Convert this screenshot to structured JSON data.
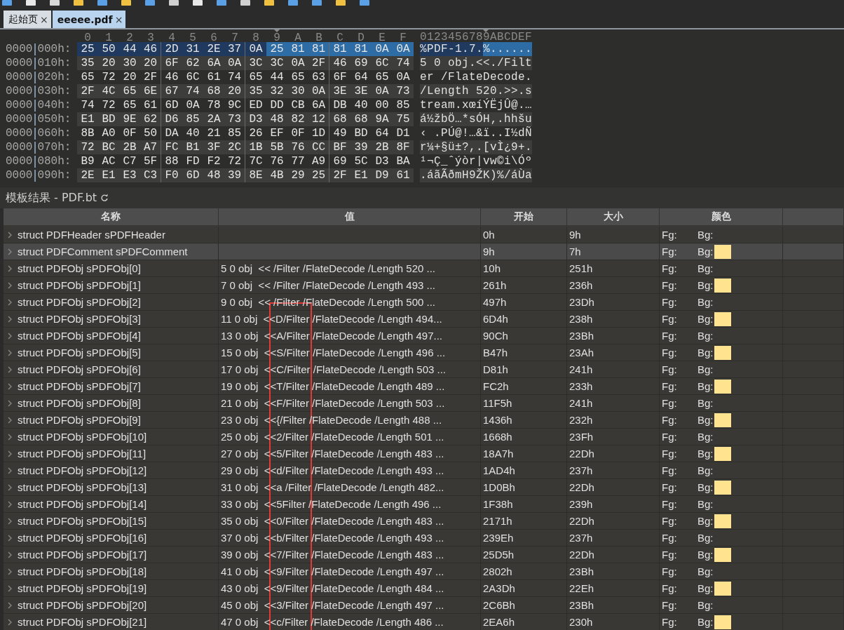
{
  "tabs": [
    {
      "label": "起始页",
      "close": "×",
      "selected": false
    },
    {
      "label": "eeeee.pdf",
      "close": "×",
      "selected": true
    }
  ],
  "hex_view": {
    "column_headers": [
      "0",
      "1",
      "2",
      "3",
      "4",
      "5",
      "6",
      "7",
      "8",
      "9",
      "A",
      "B",
      "C",
      "D",
      "E",
      "F"
    ],
    "text_header": "0123456789ABCDEF",
    "rows": [
      {
        "segment": "0000",
        "offset": "000h:",
        "cells": [
          {
            "bytes": "25 50 44 46 2D 31 2E 37 0A",
            "selected": true,
            "cursor": false
          },
          {
            "bytes": "25 81 81 81 81 0A 0A",
            "selected": true,
            "cursor": true
          }
        ],
        "text": [
          {
            "text": "%PDF-1.7.",
            "selected": true,
            "cursor": false
          },
          {
            "text": "%......",
            "selected": true,
            "cursor": true
          }
        ]
      },
      {
        "segment": "0000",
        "offset": "010h:",
        "cells": [
          {
            "bytes": "35 20 30 20 6F 62 6A 0A 3C 3C 0A 2F 46 69 6C 74",
            "selected": false,
            "cursor": false
          }
        ],
        "text": [
          {
            "text": "5 0 obj.<<./Filt",
            "selected": false,
            "cursor": false
          }
        ]
      },
      {
        "segment": "0000",
        "offset": "020h:",
        "cells": [
          {
            "bytes": "65 72 20 2F 46 6C 61 74 65 44 65 63 6F 64 65 0A",
            "selected": false,
            "cursor": false
          }
        ],
        "text": [
          {
            "text": "er /FlateDecode.",
            "selected": false,
            "cursor": false
          }
        ]
      },
      {
        "segment": "0000",
        "offset": "030h:",
        "cells": [
          {
            "bytes": "2F 4C 65 6E 67 74 68 20 35 32 30 0A 3E 3E 0A 73",
            "selected": false,
            "cursor": false
          }
        ],
        "text": [
          {
            "text": "/Length 520.>>.s",
            "selected": false,
            "cursor": false
          }
        ]
      },
      {
        "segment": "0000",
        "offset": "040h:",
        "cells": [
          {
            "bytes": "74 72 65 61 6D 0A 78 9C ED DD CB 6A DB 40 00 85",
            "selected": false,
            "cursor": false
          }
        ],
        "text": [
          {
            "text": "tream.xœíÝËjÛ@.…",
            "selected": false,
            "cursor": false
          }
        ]
      },
      {
        "segment": "0000",
        "offset": "050h:",
        "cells": [
          {
            "bytes": "E1 BD 9E 62 D6 85 2A 73 D3 48 82 12 68 68 9A 75",
            "selected": false,
            "cursor": false
          }
        ],
        "text": [
          {
            "text": "á½žbÖ…*sÓH‚.hhšu",
            "selected": false,
            "cursor": false
          }
        ]
      },
      {
        "segment": "0000",
        "offset": "060h:",
        "cells": [
          {
            "bytes": "8B A0 0F 50 DA 40 21 85 26 EF 0F 1D 49 BD 64 D1",
            "selected": false,
            "cursor": false
          }
        ],
        "text": [
          {
            "text": "‹ .PÚ@!…&ï..I½dÑ",
            "selected": false,
            "cursor": false
          }
        ]
      },
      {
        "segment": "0000",
        "offset": "070h:",
        "cells": [
          {
            "bytes": "72 BC 2B A7 FC B1 3F 2C 1B 5B 76 CC BF 39 2B 8F",
            "selected": false,
            "cursor": false
          }
        ],
        "text": [
          {
            "text": "r¼+§ü±?,.[vÌ¿9+.",
            "selected": false,
            "cursor": false
          }
        ]
      },
      {
        "segment": "0000",
        "offset": "080h:",
        "cells": [
          {
            "bytes": "B9 AC C7 5F 88 FD F2 72 7C 76 77 A9 69 5C D3 BA",
            "selected": false,
            "cursor": false
          }
        ],
        "text": [
          {
            "text": "¹¬Ç_ˆýòr|vw©i\\Óº",
            "selected": false,
            "cursor": false
          }
        ]
      },
      {
        "segment": "0000",
        "offset": "090h:",
        "cells": [
          {
            "bytes": "2E E1 E3 C3 F0 6D 48 39 8E 4B 29 25 2F E1 D9 61",
            "selected": false,
            "cursor": false
          }
        ],
        "text": [
          {
            "text": ".áãÃðmH9ŽK)%/áÙa",
            "selected": false,
            "cursor": false
          }
        ]
      }
    ]
  },
  "template_results": {
    "title": "模板结果 - PDF.bt",
    "columns": [
      "名称",
      "值",
      "开始",
      "大小",
      "颜色"
    ],
    "rows": [
      {
        "name": "struct PDFHeader sPDFHeader",
        "start": "0h",
        "size": "9h",
        "fg": "Fg:",
        "bg": "Bg:",
        "selected": false,
        "boxed": false
      },
      {
        "name": "struct PDFComment sPDFComment",
        "start": "9h",
        "size": "7h",
        "fg": "Fg:",
        "bg": "Bg:",
        "color": "#ffe38f",
        "selected": true,
        "boxed": false
      },
      {
        "name": "struct PDFObj sPDFObj[0]",
        "value": "5 0 obj  << /Filter /FlateDecode /Length 520 ...",
        "start": "10h",
        "size": "251h",
        "fg": "Fg:",
        "bg": "Bg:",
        "selected": false,
        "boxed": false
      },
      {
        "name": "struct PDFObj sPDFObj[1]",
        "value": "7 0 obj  << /Filter /FlateDecode /Length 493 ...",
        "start": "261h",
        "size": "236h",
        "fg": "Fg:",
        "bg": "Bg:",
        "color": "#ffe38f",
        "selected": false,
        "boxed": false
      },
      {
        "name": "struct PDFObj sPDFObj[2]",
        "value": "9 0 obj  << /Filter /FlateDecode /Length 500 ...",
        "start": "497h",
        "size": "23Dh",
        "fg": "Fg:",
        "bg": "Bg:",
        "selected": false,
        "boxed": true
      },
      {
        "name": "struct PDFObj sPDFObj[3]",
        "value": "11 0 obj  <<D/Filter /FlateDecode /Length 494...",
        "start": "6D4h",
        "size": "238h",
        "fg": "Fg:",
        "bg": "Bg:",
        "color": "#ffe38f",
        "selected": false,
        "boxed": true
      },
      {
        "name": "struct PDFObj sPDFObj[4]",
        "value": "13 0 obj  <<A/Filter /FlateDecode /Length 497...",
        "start": "90Ch",
        "size": "23Bh",
        "fg": "Fg:",
        "bg": "Bg:",
        "selected": false,
        "boxed": true
      },
      {
        "name": "struct PDFObj sPDFObj[5]",
        "value": "15 0 obj  <<S/Filter /FlateDecode /Length 496 ...",
        "start": "B47h",
        "size": "23Ah",
        "fg": "Fg:",
        "bg": "Bg:",
        "color": "#ffe38f",
        "selected": false,
        "boxed": true
      },
      {
        "name": "struct PDFObj sPDFObj[6]",
        "value": "17 0 obj  <<C/Filter /FlateDecode /Length 503 ...",
        "start": "D81h",
        "size": "241h",
        "fg": "Fg:",
        "bg": "Bg:",
        "selected": false,
        "boxed": true
      },
      {
        "name": "struct PDFObj sPDFObj[7]",
        "value": "19 0 obj  <<T/Filter /FlateDecode /Length 489 ...",
        "start": "FC2h",
        "size": "233h",
        "fg": "Fg:",
        "bg": "Bg:",
        "color": "#ffe38f",
        "selected": false,
        "boxed": true
      },
      {
        "name": "struct PDFObj sPDFObj[8]",
        "value": "21 0 obj  <<F/Filter /FlateDecode /Length 503 ...",
        "start": "11F5h",
        "size": "241h",
        "fg": "Fg:",
        "bg": "Bg:",
        "selected": false,
        "boxed": true
      },
      {
        "name": "struct PDFObj sPDFObj[9]",
        "value": "23 0 obj  <<{/Filter /FlateDecode /Length 488 ...",
        "start": "1436h",
        "size": "232h",
        "fg": "Fg:",
        "bg": "Bg:",
        "color": "#ffe38f",
        "selected": false,
        "boxed": true
      },
      {
        "name": "struct PDFObj sPDFObj[10]",
        "value": "25 0 obj  <<2/Filter /FlateDecode /Length 501 ...",
        "start": "1668h",
        "size": "23Fh",
        "fg": "Fg:",
        "bg": "Bg:",
        "selected": false,
        "boxed": true
      },
      {
        "name": "struct PDFObj sPDFObj[11]",
        "value": "27 0 obj  <<5/Filter /FlateDecode /Length 483 ...",
        "start": "18A7h",
        "size": "22Dh",
        "fg": "Fg:",
        "bg": "Bg:",
        "color": "#ffe38f",
        "selected": false,
        "boxed": true
      },
      {
        "name": "struct PDFObj sPDFObj[12]",
        "value": "29 0 obj  <<d/Filter /FlateDecode /Length 493 ...",
        "start": "1AD4h",
        "size": "237h",
        "fg": "Fg:",
        "bg": "Bg:",
        "selected": false,
        "boxed": true
      },
      {
        "name": "struct PDFObj sPDFObj[13]",
        "value": "31 0 obj  <<a /Filter /FlateDecode /Length 482...",
        "start": "1D0Bh",
        "size": "22Dh",
        "fg": "Fg:",
        "bg": "Bg:",
        "color": "#ffe38f",
        "selected": false,
        "boxed": true
      },
      {
        "name": "struct PDFObj sPDFObj[14]",
        "value": "33 0 obj  <<5Filter /FlateDecode /Length 496 ...",
        "start": "1F38h",
        "size": "239h",
        "fg": "Fg:",
        "bg": "Bg:",
        "selected": false,
        "boxed": true
      },
      {
        "name": "struct PDFObj sPDFObj[15]",
        "value": "35 0 obj  <<0/Filter /FlateDecode /Length 483 ...",
        "start": "2171h",
        "size": "22Dh",
        "fg": "Fg:",
        "bg": "Bg:",
        "color": "#ffe38f",
        "selected": false,
        "boxed": true
      },
      {
        "name": "struct PDFObj sPDFObj[16]",
        "value": "37 0 obj  <<b/Filter /FlateDecode /Length 493 ...",
        "start": "239Eh",
        "size": "237h",
        "fg": "Fg:",
        "bg": "Bg:",
        "selected": false,
        "boxed": true
      },
      {
        "name": "struct PDFObj sPDFObj[17]",
        "value": "39 0 obj  <<7/Filter /FlateDecode /Length 483 ...",
        "start": "25D5h",
        "size": "22Dh",
        "fg": "Fg:",
        "bg": "Bg:",
        "color": "#ffe38f",
        "selected": false,
        "boxed": true
      },
      {
        "name": "struct PDFObj sPDFObj[18]",
        "value": "41 0 obj  <<9/Filter /FlateDecode /Length 497 ...",
        "start": "2802h",
        "size": "23Bh",
        "fg": "Fg:",
        "bg": "Bg:",
        "selected": false,
        "boxed": true
      },
      {
        "name": "struct PDFObj sPDFObj[19]",
        "value": "43 0 obj  <<9/Filter /FlateDecode /Length 484 ...",
        "start": "2A3Dh",
        "size": "22Eh",
        "fg": "Fg:",
        "bg": "Bg:",
        "color": "#ffe38f",
        "selected": false,
        "boxed": true
      },
      {
        "name": "struct PDFObj sPDFObj[20]",
        "value": "45 0 obj  <<3/Filter /FlateDecode /Length 497 ...",
        "start": "2C6Bh",
        "size": "23Bh",
        "fg": "Fg:",
        "bg": "Bg:",
        "selected": false,
        "boxed": true
      },
      {
        "name": "struct PDFObj sPDFObj[21]",
        "value": "47 0 obj  <<c/Filter /FlateDecode /Length 486 ...",
        "start": "2EA6h",
        "size": "230h",
        "fg": "Fg:",
        "bg": "Bg:",
        "color": "#ffe38f",
        "selected": false,
        "boxed": true
      }
    ]
  }
}
